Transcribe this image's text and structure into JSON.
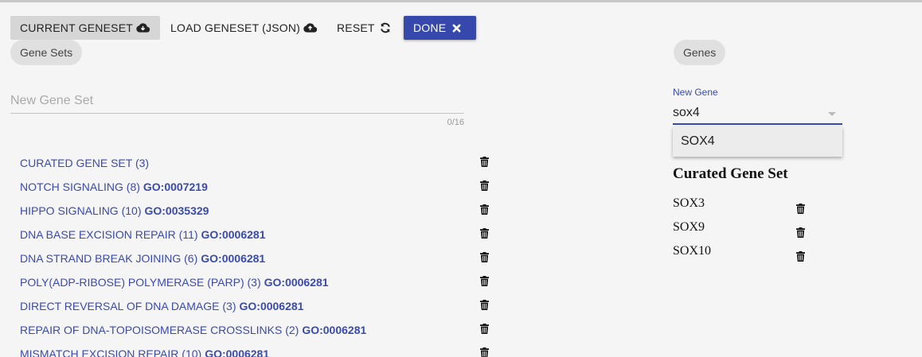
{
  "toolbar": {
    "current_label": "CURRENT GENESET",
    "load_label": "LOAD GENESET (JSON)",
    "reset_label": "RESET",
    "done_label": "DONE"
  },
  "chips": {
    "gene_sets": "Gene Sets",
    "genes": "Genes"
  },
  "new_gene_set": {
    "placeholder": "New Gene Set",
    "value": "",
    "counter": "0/16"
  },
  "gene_sets": [
    {
      "name": "CURATED GENE SET (3)",
      "go": ""
    },
    {
      "name": "NOTCH SIGNALING (8)",
      "go": "GO:0007219"
    },
    {
      "name": "HIPPO SIGNALING (10)",
      "go": "GO:0035329"
    },
    {
      "name": "DNA BASE EXCISION REPAIR (11)",
      "go": "GO:0006281"
    },
    {
      "name": "DNA STRAND BREAK JOINING (6)",
      "go": "GO:0006281"
    },
    {
      "name": "POLY(ADP-RIBOSE) POLYMERASE (PARP) (3)",
      "go": "GO:0006281"
    },
    {
      "name": "DIRECT REVERSAL OF DNA DAMAGE (3)",
      "go": "GO:0006281"
    },
    {
      "name": "REPAIR OF DNA-TOPOISOMERASE CROSSLINKS (2)",
      "go": "GO:0006281"
    },
    {
      "name": "MISMATCH EXCISION REPAIR (10)",
      "go": "GO:0006281"
    }
  ],
  "new_gene": {
    "label": "New Gene",
    "value": "sox4",
    "suggestion": "SOX4"
  },
  "selected_set": {
    "title": "Curated Gene Set",
    "genes": [
      "SOX3",
      "SOX9",
      "SOX10"
    ]
  },
  "colors": {
    "accent": "#3748ac",
    "link": "#3a4bae",
    "chip": "#e0e0e0",
    "background": "#f5f5f5"
  },
  "icons": {
    "current": "cloud-download-icon",
    "load": "cloud-upload-icon",
    "reset": "refresh-icon",
    "done": "close-icon",
    "delete": "trash-icon"
  }
}
